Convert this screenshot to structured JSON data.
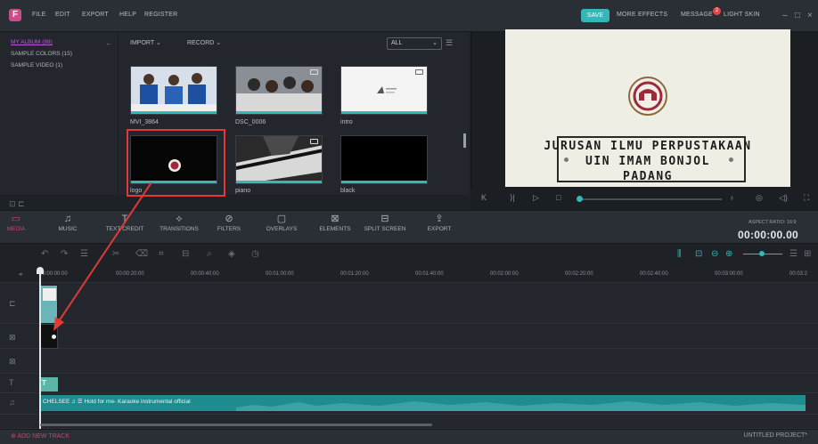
{
  "app": {
    "logo_letter": "F"
  },
  "menu": [
    "FILE",
    "EDIT",
    "EXPORT",
    "HELP",
    "REGISTER"
  ],
  "top_right": {
    "save": "SAVE",
    "more_effects": "MORE EFFECTS",
    "message": "MESSAGE",
    "message_count": "2",
    "light_skin": "LIGHT SKIN"
  },
  "album": {
    "items": [
      "MY ALBUM (89)",
      "SAMPLE COLORS (15)",
      "SAMPLE VIDEO (1)"
    ]
  },
  "library": {
    "import_label": "IMPORT",
    "record_label": "RECORD",
    "filter_value": "ALL",
    "media": [
      {
        "name": "MVI_3864",
        "kind": "video"
      },
      {
        "name": "DSC_0006",
        "kind": "video"
      },
      {
        "name": "intro",
        "kind": "video"
      },
      {
        "name": "logo",
        "kind": "image"
      },
      {
        "name": "piano",
        "kind": "video"
      },
      {
        "name": "black",
        "kind": "color"
      }
    ]
  },
  "preview": {
    "title_lines": [
      "JURUSAN ILMU PERPUSTAKAAN",
      "UIN IMAM BONJOL",
      "PADANG"
    ]
  },
  "toolbar": {
    "tabs": [
      "MEDIA",
      "MUSIC",
      "TEXT/CREDIT",
      "TRANSITIONS",
      "FILTERS",
      "OVERLAYS",
      "ELEMENTS",
      "SPLIT SCREEN",
      "EXPORT"
    ],
    "aspect_ratio": "ASPECT RATIO: 16:9",
    "timecode": "00:00:00.00"
  },
  "timeline": {
    "ticks": [
      "00:00:00:00",
      "00:00:20:00",
      "00:00:40:00",
      "00:01:00:00",
      "00:01:20:00",
      "00:01:40:00",
      "00:02:00:00",
      "00:02:20:00",
      "00:02:40:00",
      "00:03:00:00",
      "00:03:2"
    ],
    "title_clip": "T",
    "audio_clip": "CHELSEE ♫ ☰ Hold for me- Karaoke instrumental official"
  },
  "bottom": {
    "add_track": "ADD NEW TRACK",
    "project": "UNTITLED PROJECT*"
  },
  "colors": {
    "accent": "#35b6b8",
    "active_tab": "#c14a6e",
    "highlight": "#e53935"
  }
}
